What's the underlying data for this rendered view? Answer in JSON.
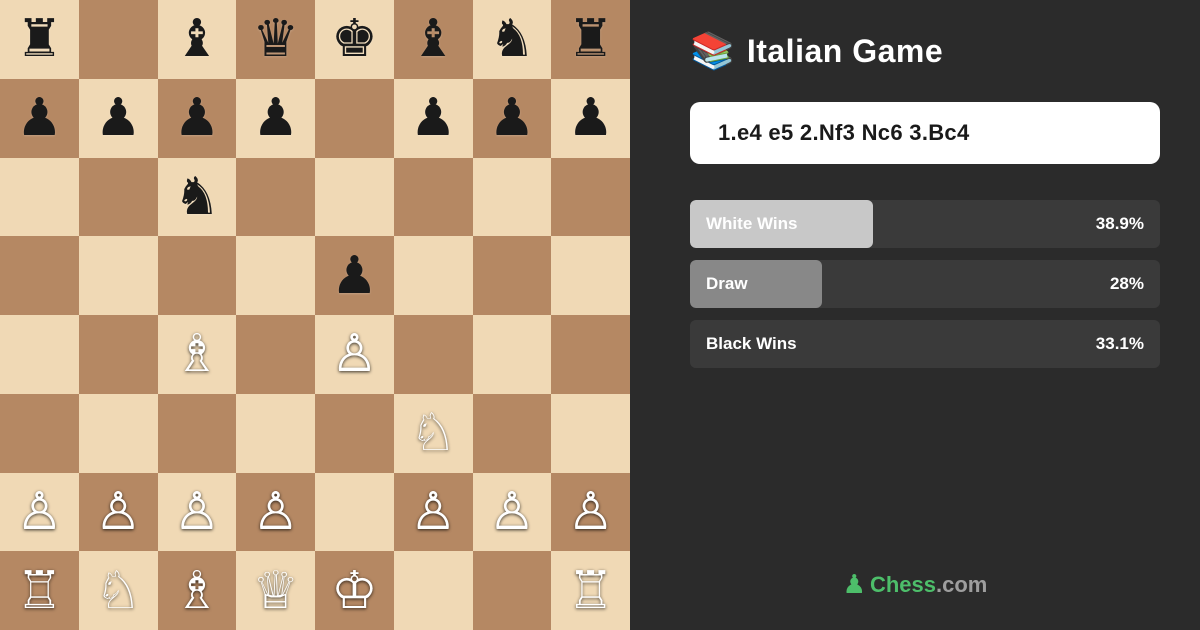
{
  "opening": {
    "icon": "📚",
    "title": "Italian Game",
    "moves": "1.e4 e5 2.Nf3 Nc6 3.Bc4"
  },
  "stats": [
    {
      "id": "white-wins",
      "label": "White Wins",
      "pct": "38.9%",
      "bar_pct": 38.9,
      "bar_class": "stat-bar-white"
    },
    {
      "id": "draw",
      "label": "Draw",
      "pct": "28%",
      "bar_pct": 28,
      "bar_class": "stat-bar-draw"
    },
    {
      "id": "black-wins",
      "label": "Black Wins",
      "pct": "33.1%",
      "bar_pct": 33.1,
      "bar_class": "stat-bar-black"
    }
  ],
  "logo": {
    "icon": "♟",
    "text_green": "Chess",
    "text_gray": ".com"
  },
  "board": {
    "description": "Italian Game position after 1.e4 e5 2.Nf3 Nc6 3.Bc4"
  }
}
